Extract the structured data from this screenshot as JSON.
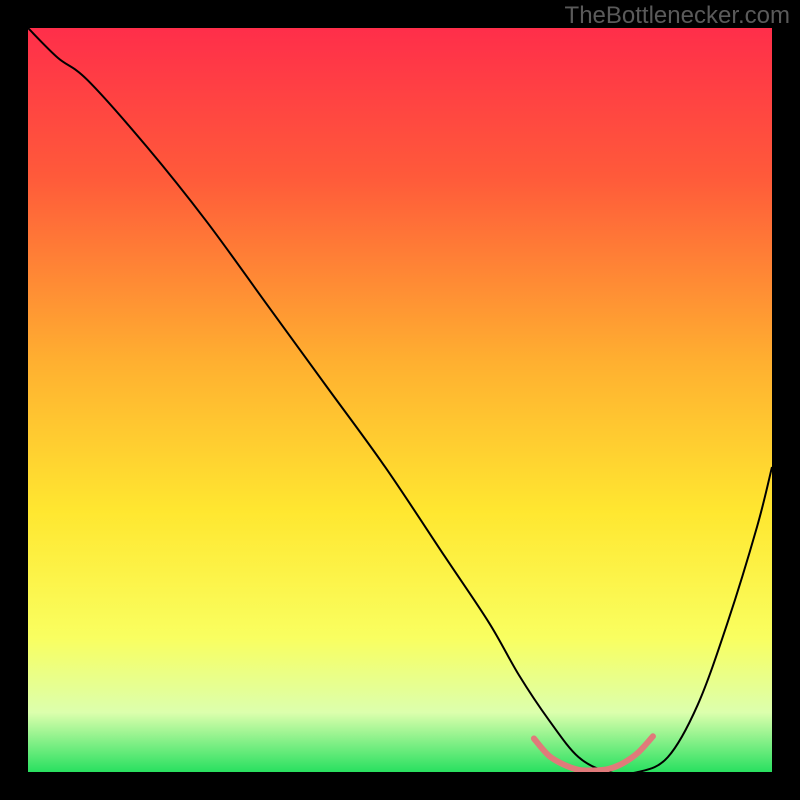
{
  "watermark": "TheBottlenecker.com",
  "chart_data": {
    "type": "line",
    "title": "",
    "xlabel": "",
    "ylabel": "",
    "xlim": [
      0,
      100
    ],
    "ylim": [
      0,
      100
    ],
    "gradient_stops": [
      {
        "offset": 0,
        "color": "#ff2e4a"
      },
      {
        "offset": 20,
        "color": "#ff5a3a"
      },
      {
        "offset": 45,
        "color": "#ffb030"
      },
      {
        "offset": 65,
        "color": "#ffe730"
      },
      {
        "offset": 82,
        "color": "#f9ff60"
      },
      {
        "offset": 92,
        "color": "#dcffad"
      },
      {
        "offset": 100,
        "color": "#28e060"
      }
    ],
    "series": [
      {
        "name": "bottleneck-curve",
        "color": "#000000",
        "width": 2,
        "x": [
          0,
          4,
          8,
          16,
          24,
          32,
          40,
          48,
          56,
          62,
          66,
          70,
          74,
          78,
          82,
          86,
          90,
          94,
          98,
          100
        ],
        "y": [
          100,
          96,
          93,
          84,
          74,
          63,
          52,
          41,
          29,
          20,
          13,
          7,
          2,
          0,
          0,
          2,
          9,
          20,
          33,
          41
        ]
      }
    ],
    "highlight": {
      "name": "optimal-range",
      "color": "#e07a7a",
      "width": 6,
      "x": [
        68,
        70,
        72,
        74,
        76,
        78,
        80,
        82,
        84
      ],
      "y": [
        4.5,
        2.2,
        1.0,
        0.3,
        0.2,
        0.4,
        1.2,
        2.6,
        4.8
      ]
    }
  }
}
